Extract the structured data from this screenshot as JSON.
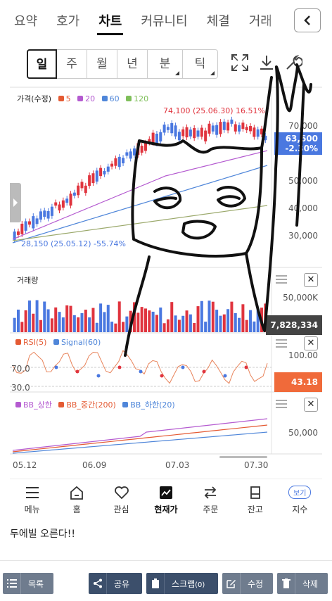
{
  "tabs": [
    "요약",
    "호가",
    "차트",
    "커뮤니티",
    "체결",
    "거래"
  ],
  "active_tab": "차트",
  "period_buttons": [
    "일",
    "주",
    "월",
    "년",
    "분",
    "틱"
  ],
  "price_panel": {
    "title": "가격(수정)",
    "ma_legend": [
      {
        "label": "5",
        "color": "#e45a33"
      },
      {
        "label": "20",
        "color": "#b45ad0"
      },
      {
        "label": "60",
        "color": "#4f86d9"
      },
      {
        "label": "120",
        "color": "#7fbf5a"
      }
    ],
    "high_annotation": "74,100 (25.06.30) 16.51%",
    "low_annotation": "28,150 (25.05.12) -55.74%",
    "y_labels": [
      "70,000",
      "50,000",
      "40,000",
      "30,000"
    ],
    "current_price_tag": [
      "63,600",
      "-2.30%"
    ]
  },
  "volume_panel": {
    "title": "거래량",
    "y_label": "50,000K",
    "current_tag": "7,828,334"
  },
  "rsi_panel": {
    "legend": [
      {
        "label": "RSI(5)",
        "color": "#e45a33"
      },
      {
        "label": "Signal(60)",
        "color": "#4f86d9"
      }
    ],
    "levels": [
      "70.0",
      "30.0"
    ],
    "y_label": "100.00",
    "current_tag": "43.18"
  },
  "bb_panel": {
    "legend": [
      {
        "label": "BB_상한",
        "color": "#b45ad0"
      },
      {
        "label": "BB_중간(200)",
        "color": "#e45a33"
      },
      {
        "label": "BB_하한(20)",
        "color": "#4f86d9"
      }
    ],
    "y_label": "50,000"
  },
  "x_dates": [
    "05.12",
    "06.09",
    "07.03",
    "07.30"
  ],
  "bottom_nav": [
    {
      "label": "메뉴",
      "icon": "menu-icon"
    },
    {
      "label": "홈",
      "icon": "home-icon"
    },
    {
      "label": "관심",
      "icon": "heart-icon"
    },
    {
      "label": "현재가",
      "icon": "trend-icon"
    },
    {
      "label": "주문",
      "icon": "swap-icon"
    },
    {
      "label": "잔고",
      "icon": "wallet-icon"
    },
    {
      "label": "지수",
      "icon": "index-icon",
      "badge": "보기"
    }
  ],
  "post_text": "두에빌 오른다!!",
  "actions": {
    "list": "목록",
    "share": "공유",
    "scrap": "스크랩",
    "scrap_count": "(0)",
    "edit": "수정",
    "delete": "삭제"
  },
  "colors": {
    "up": "#e0343e",
    "down": "#4a78e0",
    "price_tag": "#4a78e0",
    "rsi_tag": "#f06a3a",
    "action_bar": "#3c4f6b"
  }
}
